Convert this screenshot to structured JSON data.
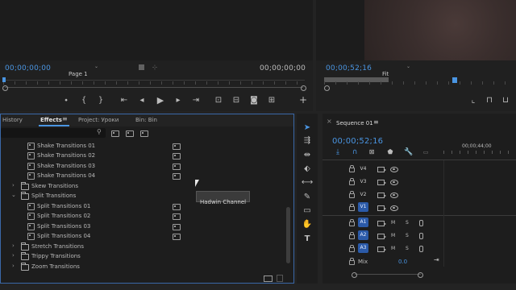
{
  "source_monitor": {
    "timecode_left": "00;00;00;00",
    "page_select": "Page 1",
    "timecode_right": "00;00;00;00"
  },
  "program_monitor": {
    "timecode": "00;00;52;16",
    "fit_select": "Fit"
  },
  "effects_panel": {
    "tabs": [
      "History",
      "Effects",
      "Project: Уроки",
      "Bin: Bin"
    ],
    "active_tab": "Effects",
    "search_value": "",
    "items": [
      {
        "label": "Shake Transitions 01",
        "kind": "item"
      },
      {
        "label": "Shake Transitions 02",
        "kind": "item"
      },
      {
        "label": "Shake Transitions 03",
        "kind": "item"
      },
      {
        "label": "Shake Transitions 04",
        "kind": "item"
      },
      {
        "label": "Skew Transitions",
        "kind": "folder"
      },
      {
        "label": "Split Transitions",
        "kind": "folder-open"
      },
      {
        "label": "Split Transitions 01",
        "kind": "item"
      },
      {
        "label": "Split Transitions 02",
        "kind": "item"
      },
      {
        "label": "Split Transitions 03",
        "kind": "item"
      },
      {
        "label": "Split Transitions 04",
        "kind": "item"
      },
      {
        "label": "Stretch Transitions",
        "kind": "folder"
      },
      {
        "label": "Trippy Transitions",
        "kind": "folder"
      },
      {
        "label": "Zoom Transitions",
        "kind": "folder"
      }
    ],
    "tooltip": "Hadwin Channel"
  },
  "timeline": {
    "title": "Sequence 01",
    "timecode": "00;00;52;16",
    "ruler_label": "00;00;44;00",
    "video_tracks": [
      "V4",
      "V3",
      "V2",
      "V1"
    ],
    "audio_tracks": [
      "A1",
      "A2",
      "A3"
    ],
    "mix_label": "Mix",
    "mix_value": "0.0",
    "audio_buttons": [
      "M",
      "S"
    ]
  },
  "colors": {
    "accent_blue": "#4a95e2",
    "track_blue": "#2b5aa8",
    "panel_bg": "#1d1d1d",
    "focus_border": "#3a68a8"
  }
}
